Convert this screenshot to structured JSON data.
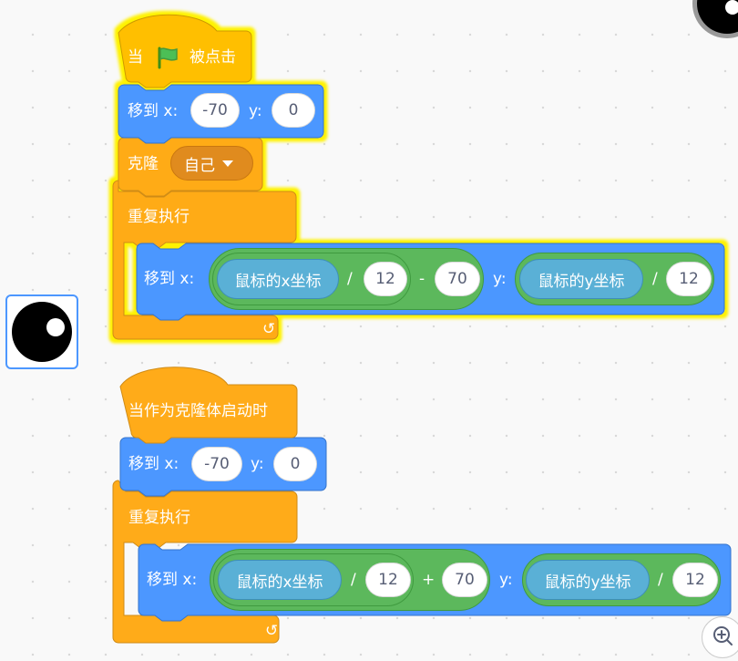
{
  "script1": {
    "hat_prefix": "当",
    "hat_suffix": "被点击",
    "goto1": {
      "label": "移到 x:",
      "x": "-70",
      "y_label": "y:",
      "y": "0"
    },
    "clone": {
      "label": "克隆",
      "target": "自己"
    },
    "forever_label": "重复执行",
    "goto2": {
      "label": "移到 x:",
      "mouse_x": "鼠标的x坐标",
      "div1": "/",
      "num1": "12",
      "op": "-",
      "num2": "70",
      "y_label": "y:",
      "mouse_y": "鼠标的y坐标",
      "div2": "/",
      "num3": "12"
    }
  },
  "script2": {
    "hat_label": "当作为克隆体启动时",
    "goto1": {
      "label": "移到 x:",
      "x": "-70",
      "y_label": "y:",
      "y": "0"
    },
    "forever_label": "重复执行",
    "goto2": {
      "label": "移到 x:",
      "mouse_x": "鼠标的x坐标",
      "div1": "/",
      "num1": "12",
      "op": "+",
      "num2": "70",
      "y_label": "y:",
      "mouse_y": "鼠标的y坐标",
      "div2": "/",
      "num3": "12"
    }
  },
  "colors": {
    "events": "#ffbf00",
    "control": "#ffab19",
    "motion": "#4c97ff",
    "operators": "#59c059",
    "sensing": "#5cb1d6",
    "glow": "#fff200"
  },
  "icons": [
    "green-flag-icon",
    "loop-arrow-icon",
    "zoom-in-icon",
    "sprite-thumbnail",
    "sprite-preview"
  ]
}
